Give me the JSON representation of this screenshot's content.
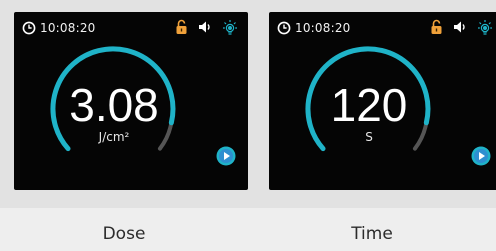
{
  "screens": [
    {
      "time": "10:08:20",
      "value": "3.08",
      "unit": "J/cm²",
      "caption": "Dose",
      "icons": [
        "clock-icon",
        "unlock-icon",
        "volume-icon",
        "light-bulb-icon",
        "play-icon"
      ]
    },
    {
      "time": "10:08:20",
      "value": "120",
      "unit": "S",
      "caption": "Time",
      "icons": [
        "clock-icon",
        "unlock-icon",
        "volume-icon",
        "light-bulb-icon",
        "play-icon"
      ]
    }
  ],
  "colors": {
    "accent": "#1fb3c8",
    "track": "#555555",
    "lock": "#f0a13a",
    "screen": "#050505"
  }
}
